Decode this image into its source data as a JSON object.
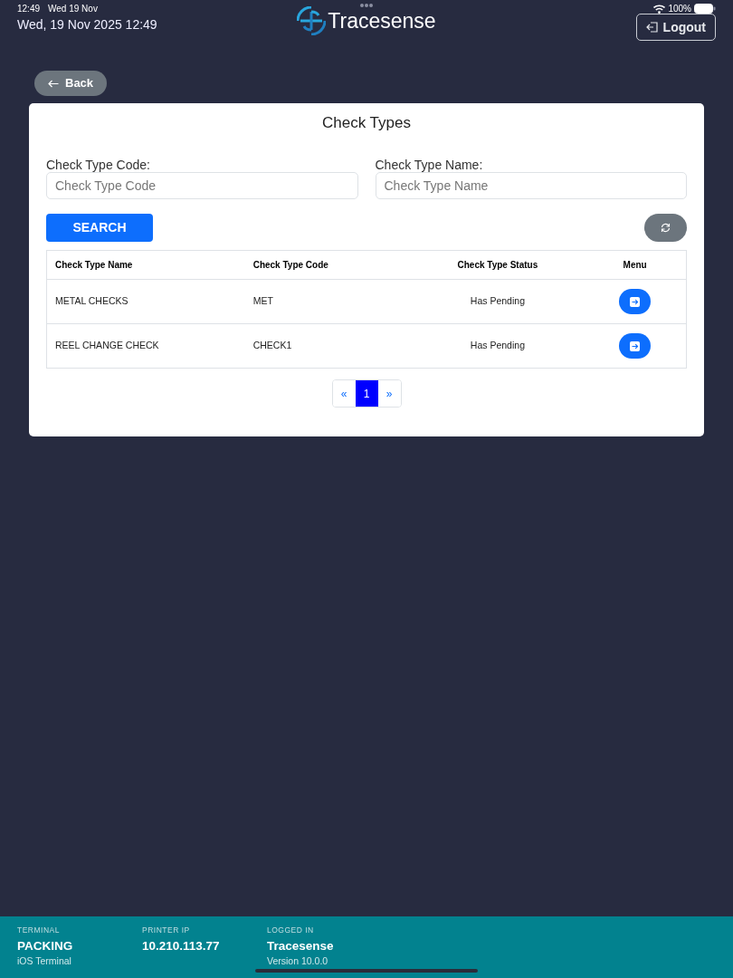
{
  "status_bar": {
    "time": "12:49",
    "date": "Wed 19 Nov",
    "battery": "100%"
  },
  "header": {
    "datetime": "Wed, 19 Nov 2025 12:49",
    "brand": "Tracesense",
    "logout": "Logout"
  },
  "back": "Back",
  "panel": {
    "title": "Check Types",
    "fields": [
      {
        "label": "Check Type Code:",
        "placeholder": "Check Type Code"
      },
      {
        "label": "Check Type Name:",
        "placeholder": "Check Type Name"
      }
    ],
    "search": "SEARCH",
    "table": {
      "columns": [
        "Check Type Name",
        "Check Type Code",
        "Check Type Status",
        "Menu"
      ],
      "rows": [
        {
          "name": "METAL CHECKS",
          "code": "MET",
          "status": "Has Pending"
        },
        {
          "name": "REEL CHANGE CHECK",
          "code": "CHECK1",
          "status": "Has Pending"
        }
      ]
    },
    "pagination": [
      {
        "label": "«",
        "selected": false
      },
      {
        "label": "1",
        "selected": true
      },
      {
        "label": "»",
        "selected": false
      }
    ]
  },
  "footer": [
    {
      "label": "TERMINAL",
      "value": "PACKING",
      "sub": "iOS Terminal"
    },
    {
      "label": "PRINTER IP",
      "value": "10.210.113.77"
    },
    {
      "label": "LOGGED IN",
      "value": "Tracesense",
      "sub": "Version 10.0.0"
    }
  ]
}
